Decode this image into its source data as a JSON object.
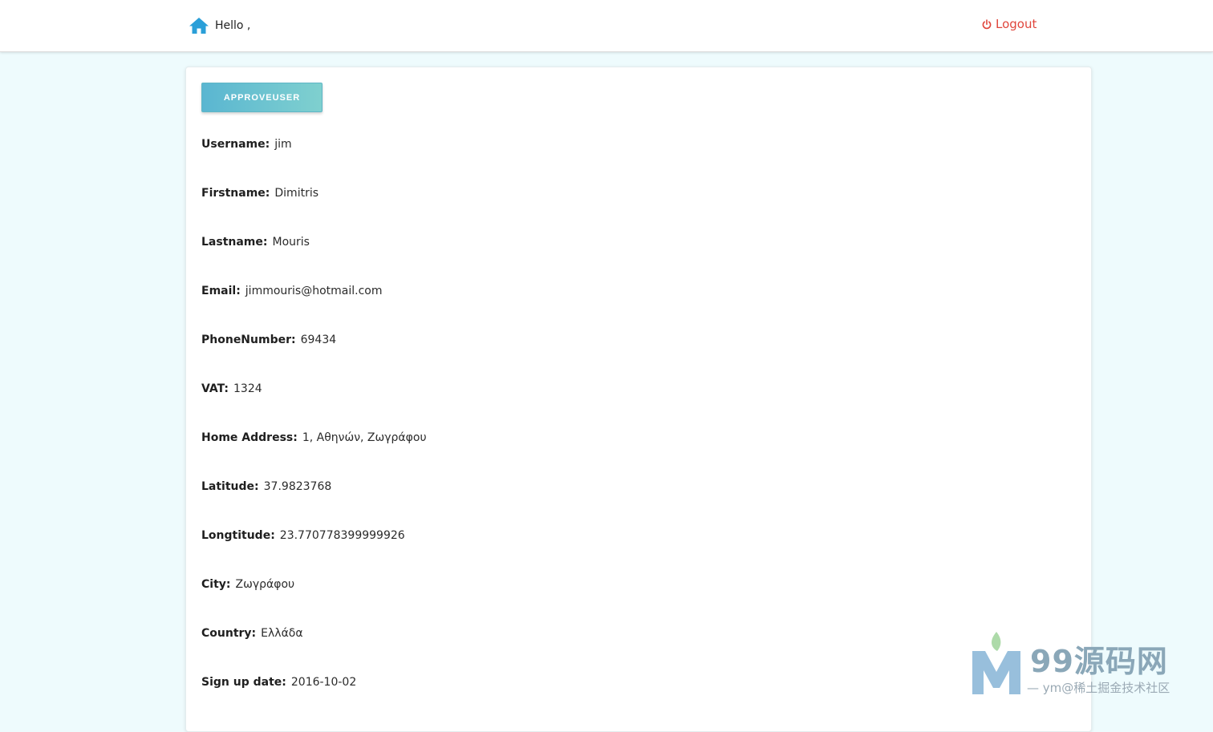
{
  "header": {
    "greeting": "Hello ,",
    "logout_label": "Logout",
    "logout_color": "#e0463c",
    "home_icon_color": "#2a9fd8"
  },
  "card": {
    "approve_button_label": "APPROVEUSER",
    "fields": [
      {
        "label": "Username:",
        "value": "jim"
      },
      {
        "label": "Firstname:",
        "value": "Dimitris"
      },
      {
        "label": "Lastname:",
        "value": "Mouris"
      },
      {
        "label": "Email:",
        "value": "jimmouris@hotmail.com"
      },
      {
        "label": "PhoneNumber:",
        "value": "69434"
      },
      {
        "label": "VAT:",
        "value": "1324"
      },
      {
        "label": "Home Address:",
        "value": "1, Αθηνών, Ζωγράφου"
      },
      {
        "label": "Latitude:",
        "value": "37.9823768"
      },
      {
        "label": "Longtitude:",
        "value": "23.770778399999926"
      },
      {
        "label": "City:",
        "value": "Ζωγράφου"
      },
      {
        "label": "Country:",
        "value": "Ελλάδα"
      },
      {
        "label": "Sign up date:",
        "value": "2016-10-02"
      }
    ]
  },
  "watermark": {
    "title": "99源码网",
    "subtitle": "— ym@稀土掘金技术社区"
  }
}
